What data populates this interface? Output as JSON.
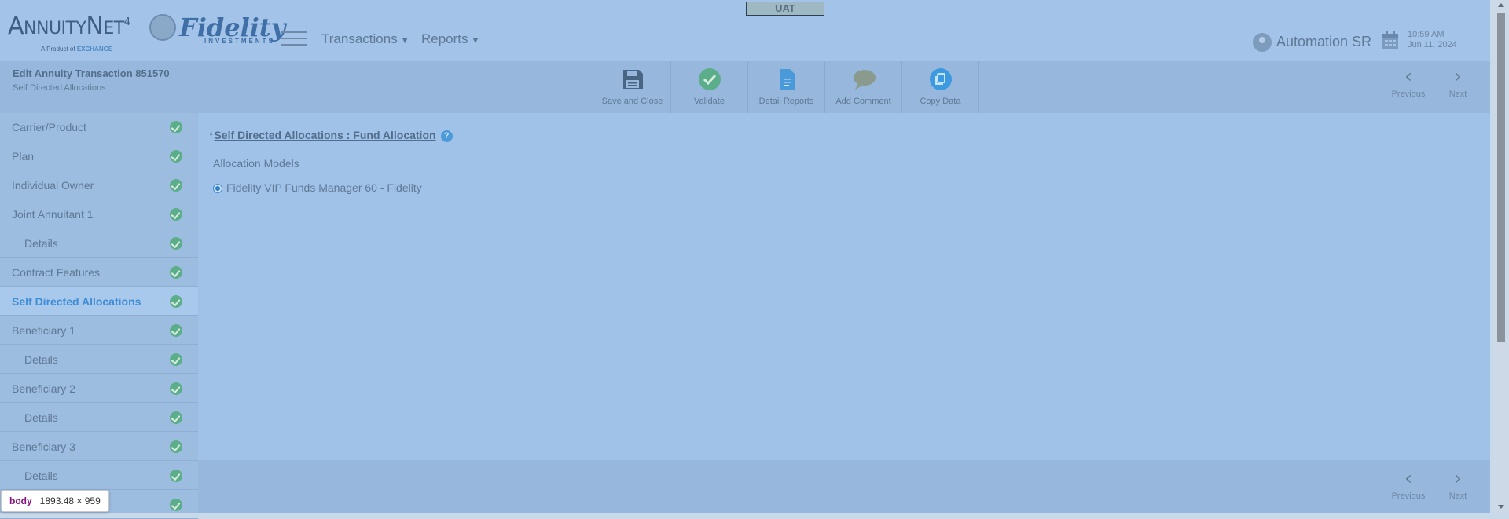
{
  "header": {
    "env_badge": "UAT",
    "logo_annuity_a": "A",
    "logo_annuity_nnuity": "NNUITY",
    "logo_annuity_n": "N",
    "logo_annuity_et": "ET",
    "logo_annuity_ver": "4",
    "logo_annuity_sub": "A Product of",
    "logo_annuity_sub2": "EXCHANGE",
    "logo_fidelity": "Fidelity",
    "logo_fidelity_sub": "INVESTMENTS",
    "menu_transactions": "Transactions",
    "menu_reports": "Reports",
    "user_name": "Automation SR",
    "time": "10:59 AM",
    "date": "Jun 11, 2024"
  },
  "page": {
    "title": "Edit Annuity Transaction 851570",
    "subtitle": "Self Directed Allocations"
  },
  "toolbar": [
    {
      "label": "Save and Close",
      "icon": "floppy-disk-icon"
    },
    {
      "label": "Validate",
      "icon": "checkmark-icon"
    },
    {
      "label": "Detail Reports",
      "icon": "document-icon"
    },
    {
      "label": "Add Comment",
      "icon": "speech-bubble-icon"
    },
    {
      "label": "Copy Data",
      "icon": "copy-icon"
    }
  ],
  "nav": {
    "previous": "Previous",
    "next": "Next",
    "prev_arrow": "‹",
    "next_arrow": "›"
  },
  "sidebar": [
    {
      "label": "Carrier/Product"
    },
    {
      "label": "Plan"
    },
    {
      "label": "Individual Owner"
    },
    {
      "label": "Joint Annuitant 1"
    },
    {
      "label": "Details"
    },
    {
      "label": "Contract Features"
    },
    {
      "label": "Self Directed Allocations"
    },
    {
      "label": "Beneficiary 1"
    },
    {
      "label": "Details"
    },
    {
      "label": "Beneficiary 2"
    },
    {
      "label": "Details"
    },
    {
      "label": "Beneficiary 3"
    },
    {
      "label": "Details"
    },
    {
      "label": ""
    }
  ],
  "main": {
    "required_marker": "*",
    "section_title": "Self Directed Allocations : Fund Allocation",
    "help": "?",
    "allocation_label": "Allocation Models",
    "allocation_option": "Fidelity VIP Funds Manager 60 - Fidelity"
  },
  "devtools": {
    "tag": "body",
    "size": "1893.48 × 959"
  },
  "colors": {
    "accent": "#3e8dd6",
    "check_green": "#5cae8a",
    "overlay": "#a3c3e8"
  }
}
